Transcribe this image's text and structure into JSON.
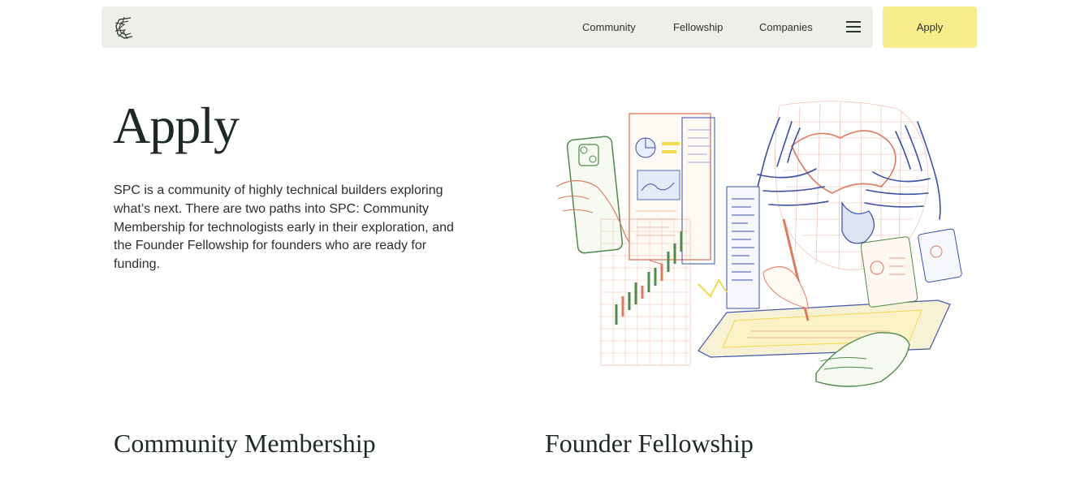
{
  "nav": {
    "logo_icon": "spc-logo-icon",
    "links": [
      "Community",
      "Fellowship",
      "Companies"
    ],
    "menu_icon": "hamburger-menu-icon",
    "apply_label": "Apply"
  },
  "hero": {
    "title": "Apply",
    "intro": "SPC is a community of highly technical builders exploring what’s next. There are two paths into SPC: Community Membership for technologists early in their exploration, and the Founder Fellowship for founders who are ready for funding."
  },
  "sections": {
    "community": "Community Membership",
    "fellowship": "Founder Fellowship"
  },
  "colors": {
    "nav_background": "#efefea",
    "apply_button": "#f8ec8c",
    "text": "#1f2a24",
    "sketch_orange": "#e07a5f",
    "sketch_blue": "#3a4fa8",
    "sketch_green": "#4f8a4a",
    "sketch_yellow": "#f2d94e"
  }
}
